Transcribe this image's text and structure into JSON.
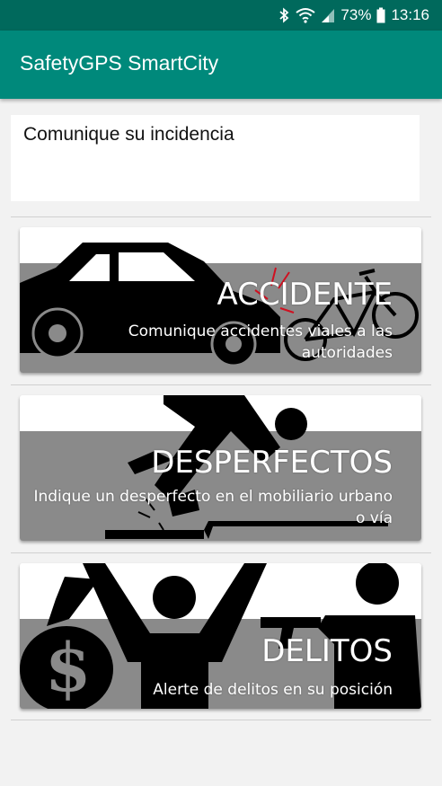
{
  "status_bar": {
    "battery": "73%",
    "time": "13:16",
    "icons": [
      "bluetooth-icon",
      "wifi-icon",
      "signal-icon",
      "battery-icon"
    ]
  },
  "app_bar": {
    "title": "SafetyGPS SmartCity"
  },
  "header": {
    "text": "Comunique su incidencia"
  },
  "cards": [
    {
      "title": "ACCIDENTE",
      "description": "Comunique accidentes viales a las autoridades",
      "icon": "car-bicycle-crash-icon"
    },
    {
      "title": "DESPERFECTOS",
      "description": "Indique un desperfecto en el mobiliario urbano o vía",
      "icon": "tripping-person-icon"
    },
    {
      "title": "DELITOS",
      "description": "Alerte de delitos en su posición",
      "icon": "robbery-icon"
    }
  ],
  "colors": {
    "status_bar": "#00695c",
    "app_bar": "#00897b",
    "band": "#8a8a8a"
  }
}
